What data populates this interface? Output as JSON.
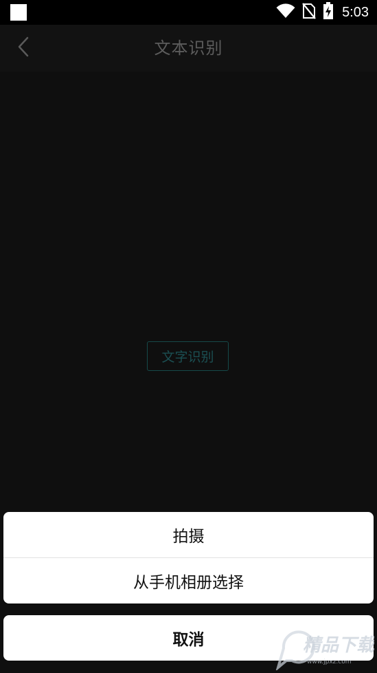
{
  "status_bar": {
    "time": "5:03",
    "icons": [
      "notification-square-icon",
      "wifi-icon",
      "no-sim-icon",
      "battery-charging-icon"
    ]
  },
  "header": {
    "back_icon": "chevron-left-icon",
    "title": "文本识别"
  },
  "main": {
    "ocr_button_label": "文字识别"
  },
  "action_sheet": {
    "items": [
      {
        "label": "拍摄"
      },
      {
        "label": "从手机相册选择"
      }
    ],
    "cancel_label": "取消"
  },
  "watermark": {
    "text": "精品下载",
    "subtext": "www.jpxz.com"
  },
  "colors": {
    "background": "#0f0f0f",
    "header_title": "#5c5c5c",
    "ocr_button": "#164a4a",
    "sheet_background": "#ffffff"
  }
}
